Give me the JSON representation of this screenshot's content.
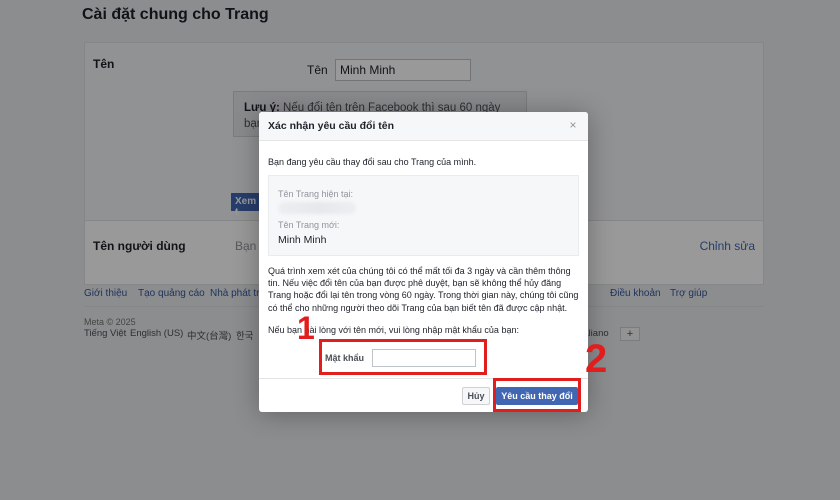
{
  "page": {
    "title": "Cài đặt chung cho Trang",
    "name_row_label": "Tên",
    "name_field_label": "Tên",
    "name_field_value": "Minh Minh",
    "note_bold": "Lưu ý:",
    "note_text": "Nếu đổi tên trên Facebook thì sau 60 ngày bạn mới",
    "view_button": "Xem t",
    "username_label": "Tên người dùng",
    "username_value": "Bạn v",
    "edit_link": "Chỉnh sửa"
  },
  "footer": {
    "links": [
      "Giới thiệu",
      "Tạo quảng cáo",
      "Nhà phát triển",
      "Điều khoản",
      "Trợ giúp"
    ],
    "copyright": "Meta © 2025",
    "languages": [
      "Tiếng Việt",
      "English (US)",
      "中文(台灣)",
      "한국",
      "Italiano"
    ],
    "more_languages": "+"
  },
  "dialog": {
    "title": "Xác nhận yêu cầu đổi tên",
    "close": "×",
    "intro": "Bạn đang yêu cầu thay đổi sau cho Trang của mình.",
    "current_name_label": "Tên Trang hiện tại:",
    "new_name_label": "Tên Trang mới:",
    "new_name_value": "Minh Minh",
    "review_text": "Quá trình xem xét của chúng tôi có thể mất tối đa 3 ngày và cần thêm thông tin. Nếu việc đổi tên của bạn được phê duyệt, bạn sẽ không thể hủy đăng Trang hoặc đổi lại tên trong vòng 60 ngày. Trong thời gian này, chúng tôi cũng có thể cho những người theo dõi Trang của bạn biết tên đã được cập nhật.",
    "password_prompt": "Nếu bạn hài lòng với tên mới, vui lòng nhập mật khẩu của bạn:",
    "password_label": "Mật khẩu",
    "password_value": "",
    "cancel_button": "Hủy",
    "submit_button": "Yêu cầu thay đổi"
  },
  "annotations": {
    "step_1": "1",
    "step_2": "2",
    "highlight_color": "#e21d1d"
  },
  "colors": {
    "brand_blue": "#4267b2",
    "link_blue": "#365899",
    "page_bg": "#e9ebee"
  }
}
